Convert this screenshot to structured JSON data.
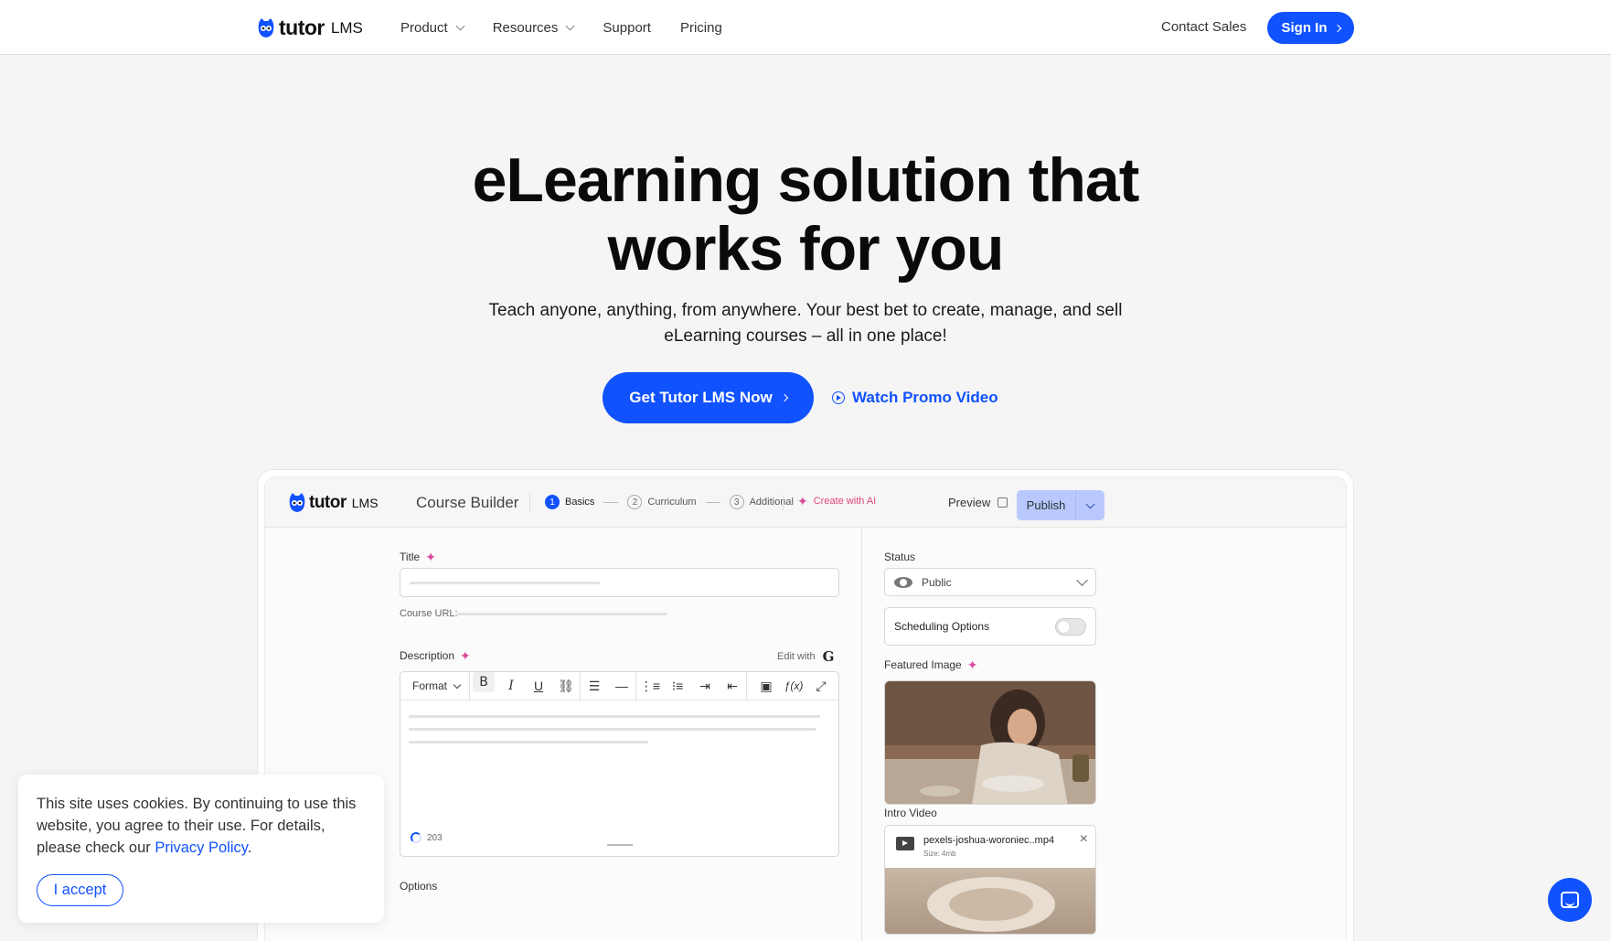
{
  "nav": {
    "logo_word": "tutor",
    "logo_suffix": "LMS",
    "links": [
      "Product",
      "Resources",
      "Support",
      "Pricing"
    ],
    "contact": "Contact Sales",
    "signin": "Sign In"
  },
  "hero": {
    "title_line1": "eLearning solution that",
    "title_line2": "works for you",
    "subtitle_line1": "Teach anyone, anything, from anywhere. Your best bet to create, manage, and sell",
    "subtitle_line2": "eLearning courses – all in one place!",
    "cta": "Get Tutor LMS Now",
    "promo": "Watch Promo Video"
  },
  "builder": {
    "logo_word": "tutor",
    "logo_suffix": "LMS",
    "title": "Course Builder",
    "steps": [
      {
        "num": "1",
        "label": "Basics"
      },
      {
        "num": "2",
        "label": "Curriculum"
      },
      {
        "num": "3",
        "label": "Additional"
      }
    ],
    "ai_label": "Create with AI",
    "preview": "Preview",
    "publish": "Publish",
    "title_label": "Title",
    "url_label": "Course URL:",
    "description_label": "Description",
    "edit_with": "Edit with",
    "format_label": "Format",
    "char_count": "203",
    "options_label": "Options",
    "status_label": "Status",
    "status_value": "Public",
    "scheduling": "Scheduling Options",
    "featured_label": "Featured Image",
    "intro_label": "Intro Video",
    "video_name": "pexels-joshua-woroniec..mp4",
    "video_size": "Size: 4mb"
  },
  "cookie": {
    "text": "This site uses cookies. By continuing to use this website, you agree to their use. For details, please check our ",
    "link": "Privacy Policy",
    "end": ".",
    "accept": "I accept"
  },
  "colors": {
    "accent": "#1152ff",
    "ai_pink": "#e0457b"
  }
}
